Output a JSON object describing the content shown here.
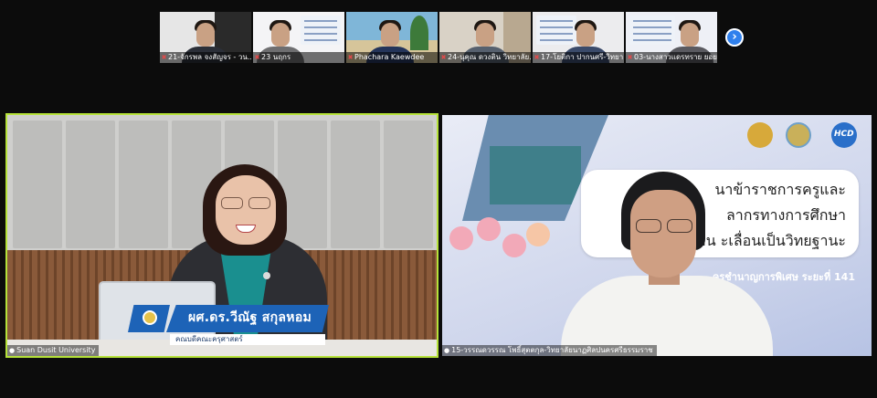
{
  "participants_strip": [
    {
      "name": "21-จักรพล จงสัญจร - วน..."
    },
    {
      "name": "23 นฤกร"
    },
    {
      "name": "Phachara Kaewdee"
    },
    {
      "name": "24-นุคุณ ดวงติน วิทยาลัย..."
    },
    {
      "name": "17-โยติกา ปากนศรี-วิทยา..."
    },
    {
      "name": "03-นางสาวแดรทราย ยอย..."
    }
  ],
  "strip_next_icon": "chevron-right-icon",
  "main_left": {
    "label": "Suan Dusit University",
    "lower_third": {
      "name": "ผศ.ดร.วีณัฐ สกุลหอม",
      "subtitle": "คณบดีคณะครุศาสตร์"
    }
  },
  "main_right": {
    "label": "15-วรรณดวรรณ โพธิ์สุตตกุล-วิทยาลัยนาฏศิลปนครศรีธรรมราช",
    "slide": {
      "title_line1": "นาข้าราชการครูและ",
      "title_line2": "ลากรทางการศึกษา",
      "title_line3": "ก่อน    ะเลื่อนเป็นวิทยฐานะ",
      "subtitle": "ครูชำนาญการพิเศษ ระยะที่ 141",
      "logo_text": "HCD"
    }
  },
  "colors": {
    "active_speaker_border": "#b6e23a",
    "lower_third_blue": "#1d63b7",
    "strip_button": "#2f80ed"
  }
}
